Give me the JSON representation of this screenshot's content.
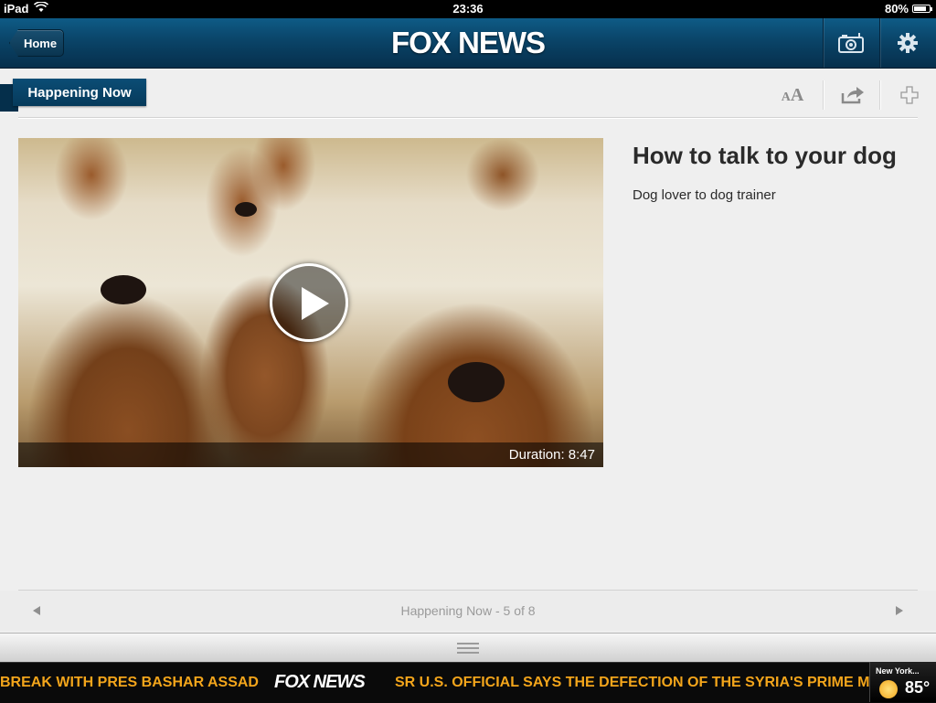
{
  "status_bar": {
    "device": "iPad",
    "time": "23:36",
    "battery": "80%",
    "battery_level": 0.8
  },
  "nav": {
    "back_label": "Home",
    "logo": "FOX NEWS"
  },
  "section": {
    "title": "Happening Now"
  },
  "toolbar": {
    "text_size_label": "AA"
  },
  "article": {
    "title": "How to talk to your dog",
    "subtitle": "Dog lover to dog trainer",
    "duration": "Duration: 8:47"
  },
  "pager": {
    "label": "Happening Now - 5 of 8"
  },
  "ticker": {
    "item1": "BREAK WITH PRES BASHAR ASSAD",
    "logo": "FOX NEWS",
    "item2": "SR U.S. OFFICIAL SAYS THE DEFECTION OF THE SYRIA'S PRIME M"
  },
  "weather": {
    "city": "New York...",
    "temp": "85°"
  },
  "colors": {
    "nav_blue": "#0a4468",
    "ticker_orange": "#f3a51b",
    "tag_blue": "#0b4d75"
  },
  "icons": [
    "wifi-icon",
    "battery-icon",
    "back-arrow-icon",
    "camera-icon",
    "gear-icon",
    "text-size-icon",
    "share-icon",
    "plus-icon",
    "play-icon",
    "left-arrow-icon",
    "right-arrow-icon",
    "drawer-handle-icon",
    "sun-icon"
  ]
}
